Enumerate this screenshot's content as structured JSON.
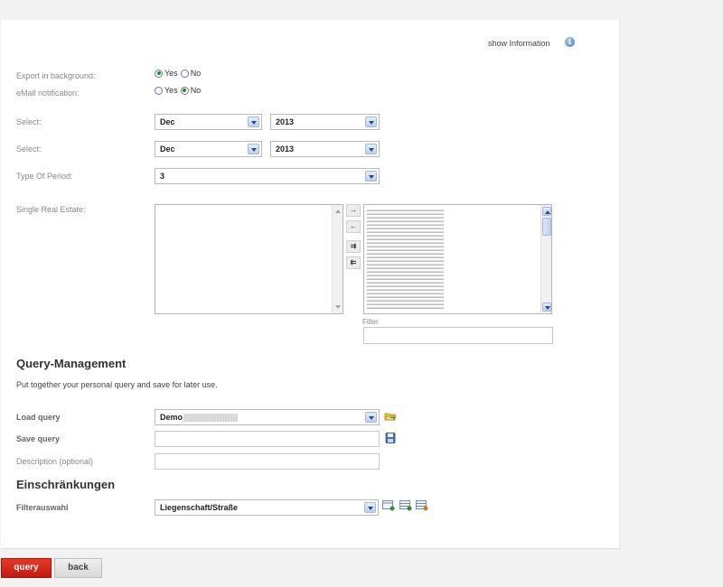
{
  "header": {
    "info_link": "show Information",
    "info_icon": "info-icon"
  },
  "form": {
    "export_background": {
      "label": "Export in background:",
      "yes": "Yes",
      "no": "No",
      "value": "Yes"
    },
    "email_notification": {
      "label": "eMail notification:",
      "yes": "Yes",
      "no": "No",
      "value": "No"
    },
    "select_from": {
      "label": "Select:",
      "month": "Dec",
      "year": "2013"
    },
    "select_to": {
      "label": "Select:",
      "month": "Dec",
      "year": "2013"
    },
    "period_type": {
      "label": "Type Of Period:",
      "value": "3"
    },
    "real_estate": {
      "label": "Single Real Estate:",
      "filter_label": "Filter",
      "filter_value": ""
    }
  },
  "move_buttons": [
    "→",
    "←",
    "⇉",
    "⇇"
  ],
  "query_management": {
    "title": "Query-Management",
    "description": "Put together your personal query and save for later use.",
    "load_label": "Load query",
    "load_value": "Demo",
    "save_label": "Save query",
    "save_value": "",
    "description_label": "Description (optional)",
    "description_value": ""
  },
  "restrictions": {
    "title": "Einschränkungen",
    "filter_label": "Filterauswahl",
    "filter_value": "Liegenschaft/Straße"
  },
  "buttons": {
    "query": "query",
    "back": "back"
  },
  "colors": {
    "accent_red": "#d4251a",
    "panel_bg": "#ffffff",
    "page_bg": "#f2f2f2"
  }
}
